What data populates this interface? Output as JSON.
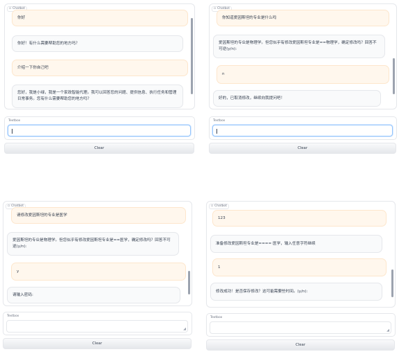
{
  "panels": [
    {
      "chatbot_label": "Chatbot",
      "messages": [
        {
          "role": "user",
          "text": "你好"
        },
        {
          "role": "bot",
          "text": "你好！有什么需要帮助您的地方吗？"
        },
        {
          "role": "user",
          "text": "介绍一下你自己吧"
        },
        {
          "role": "bot",
          "text": "您好，我是小绿，我是一个家政智能代理。我可以回答您的问题、提供信息、执行任务和管理日常事务。您有什么需要帮助您的地方吗？"
        }
      ],
      "textbox_label": "Textbox",
      "textbox_value": "",
      "clear_label": "Clear"
    },
    {
      "chatbot_label": "Chatbot",
      "messages": [
        {
          "role": "user",
          "text": "你知道爱因斯坦的专业是什么吗"
        },
        {
          "role": "bot",
          "text": "爱因斯坦的专业是物理学。但您似乎有修改爱因斯坦专业是==物理学，确定修改吗？回答不可逆(y/n):"
        },
        {
          "role": "user",
          "text": "n"
        },
        {
          "role": "bot",
          "text": "好的，已取消修改，继续向我提问吧！"
        }
      ],
      "textbox_label": "Textbox",
      "textbox_value": "",
      "clear_label": "Clear"
    },
    {
      "chatbot_label": "Chatbot",
      "messages": [
        {
          "role": "user",
          "text": "请修改爱因斯坦的专业是医学"
        },
        {
          "role": "bot",
          "text": "爱因斯坦的专业是物理学。但您似乎有修改爱因斯坦专业是==医学，确定修改吗？回答不可逆(y/n):"
        },
        {
          "role": "user",
          "text": "y"
        },
        {
          "role": "bot",
          "text": "请输入密码:"
        }
      ],
      "textbox_label": "Textbox",
      "textbox_value": "",
      "clear_label": "Clear"
    },
    {
      "chatbot_label": "Chatbot",
      "messages": [
        {
          "role": "user",
          "text": "123"
        },
        {
          "role": "bot",
          "text": "准备修改爱因斯坦专业是==== 医学，输入任意字符继续"
        },
        {
          "role": "user",
          "text": "1"
        },
        {
          "role": "bot",
          "text": "修改成功！是否保存修改？这可能需要些时间。(y/n):"
        }
      ],
      "textbox_label": "Textbox",
      "textbox_value": "",
      "clear_label": "Clear"
    }
  ]
}
